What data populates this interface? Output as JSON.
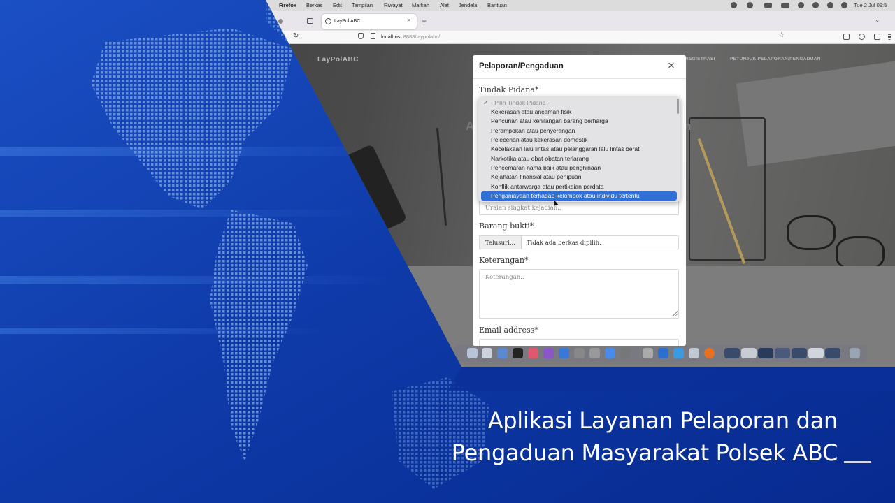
{
  "menubar": {
    "app": "Firefox",
    "items": [
      "Berkas",
      "Edit",
      "Tampilan",
      "Riwayat",
      "Markah",
      "Alat",
      "Jendela",
      "Bantuan"
    ],
    "clock": "Tue 2 Jul  09:5"
  },
  "browser": {
    "tab_title": "LayPol ABC",
    "url_host": "localhost",
    "url_path": ":8888/laypolabc/"
  },
  "site": {
    "brand": "LayPolABC",
    "nav": [
      "REGISTRASI",
      "PETUNJUK PELAPORAN/PENGADUAN"
    ],
    "hero_fragment_left": "A",
    "hero_fragment_right": "n"
  },
  "modal": {
    "title": "Pelaporan/Pengaduan",
    "close_glyph": "×",
    "fields": {
      "tindak_pidana_label": "Tindak Pidana*",
      "uraian_placeholder": "Uraian singkat kejadian..",
      "barang_bukti_label": "Barang bukti*",
      "file_button": "Telusuri...",
      "file_status": "Tidak ada berkas dipilih.",
      "keterangan_label": "Keterangan*",
      "keterangan_placeholder": "Keterangan..",
      "email_label": "Email address*"
    }
  },
  "dropdown": {
    "options": [
      "- Pilih Tindak Pidana -",
      "Kekerasan atau ancaman fisik",
      "Pencurian atau kehilangan barang berharga",
      "Perampokan atau penyerangan",
      "Pelecehan atau kekerasan domestik",
      "Kecelakaan lalu lintas atau pelanggaran lalu lintas berat",
      "Narkotika atau obat-obatan terlarang",
      "Pencemaran nama baik atau penghinaan",
      "Kejahatan finansial atau penipuan",
      "Konflik antarwarga atau pertikaian perdata",
      "Penganiayaan terhadap kelompok atau individu tertentu"
    ],
    "checked_index": 0,
    "highlighted_index": 10
  },
  "caption": {
    "line1": "Aplikasi Layanan Pelaporan dan",
    "line2": "Pengaduan Masyarakat Polsek ABC"
  },
  "colors": {
    "background_blue": "#0a2f9a",
    "highlight_blue": "#2f6fd6",
    "caption_text": "#ffffff"
  }
}
